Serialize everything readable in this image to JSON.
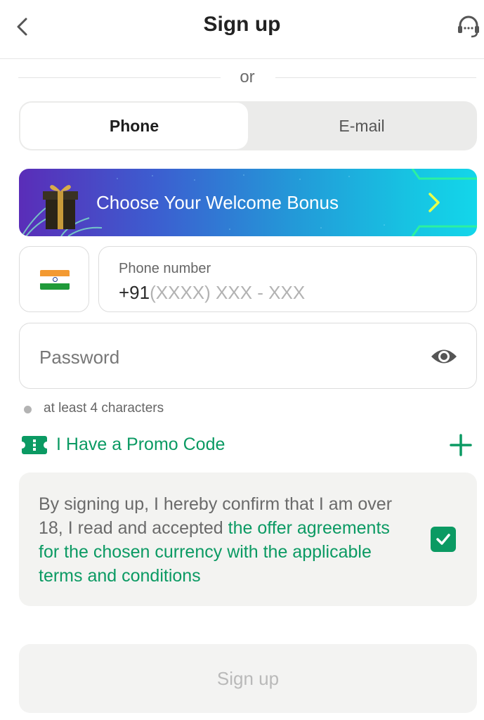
{
  "header": {
    "title": "Sign up",
    "back_icon": "chevron-left-icon",
    "support_icon": "headset-support-icon"
  },
  "divider": {
    "text": "or"
  },
  "tabs": [
    {
      "label": "Phone",
      "active": true
    },
    {
      "label": "E-mail",
      "active": false
    }
  ],
  "bonus_banner": {
    "text": "Choose Your Welcome Bonus",
    "icon": "gift-icon",
    "arrow_icon": "chevron-right-icon"
  },
  "country": {
    "flag_icon": "india-flag-icon"
  },
  "phone": {
    "label": "Phone number",
    "prefix": "+91",
    "placeholder": "(XXXX) XXX - XXX"
  },
  "password": {
    "placeholder": "Password",
    "toggle_icon": "eye-icon"
  },
  "password_hint": "at least 4 characters",
  "promo": {
    "label": "I Have a Promo Code",
    "icon": "ticket-icon",
    "add_icon": "plus-icon"
  },
  "terms": {
    "text_plain": "By signing up, I hereby confirm that I am over 18, I read and accepted ",
    "text_link": "the offer agreements for the chosen currency with the applicable terms and conditions",
    "checked": true
  },
  "signup_button": {
    "label": "Sign up"
  },
  "colors": {
    "accent_green": "#0b9a63",
    "banner_start": "#5a2db8",
    "banner_end": "#13d6ea"
  }
}
